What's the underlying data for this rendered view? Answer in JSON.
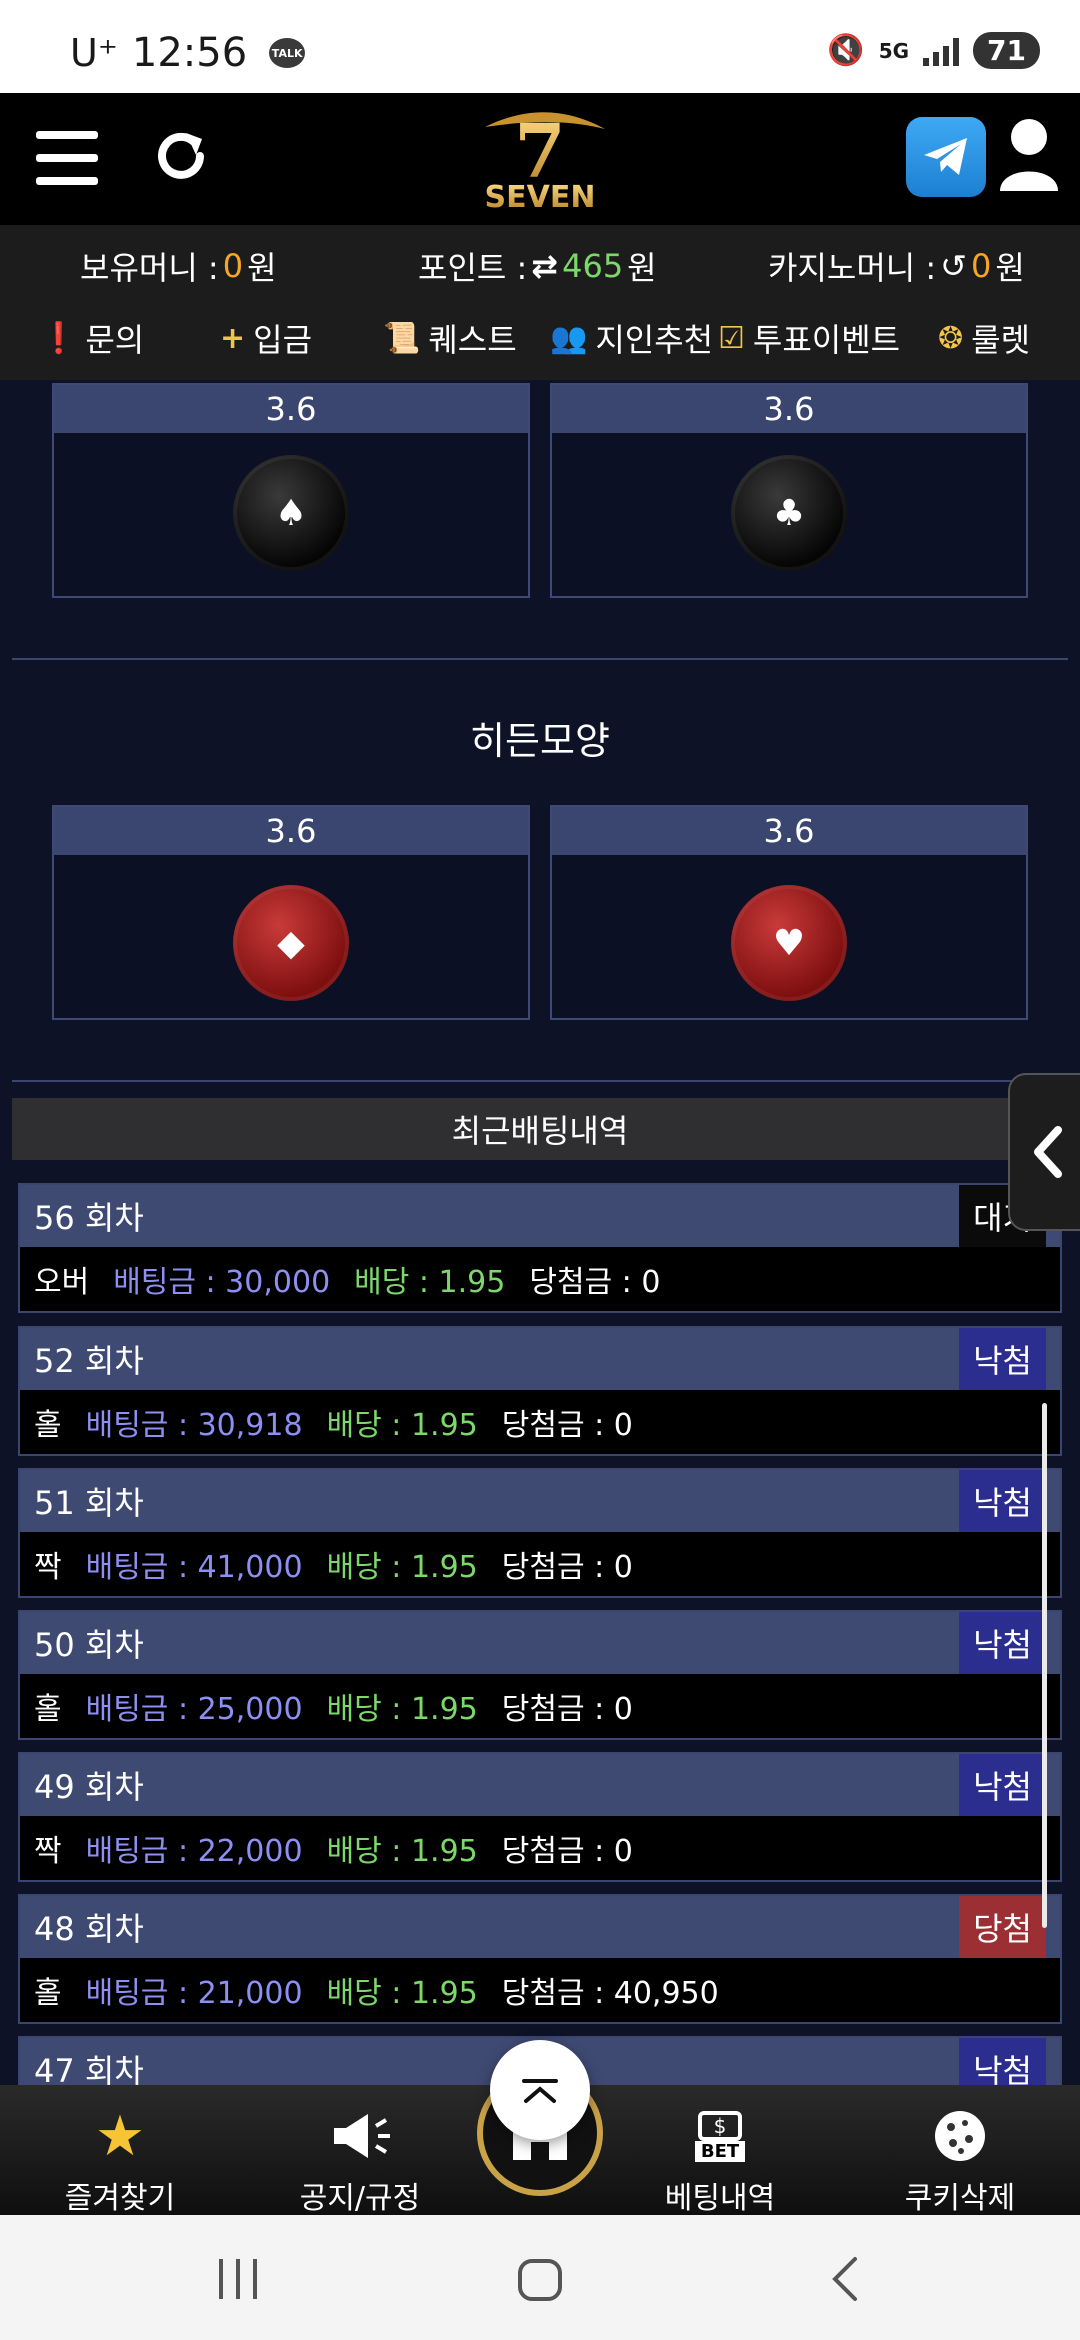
{
  "status_bar": {
    "carrier": "U⁺",
    "time": "12:56",
    "talk_label": "TALK",
    "network": "5G",
    "battery": "71"
  },
  "header": {
    "logo_text": "SEVEN",
    "logo_digit": "7"
  },
  "balance": {
    "holding_label": "보유머니 :",
    "holding_value": "0",
    "holding_unit": "원",
    "point_label": "포인트 :",
    "point_value": "465",
    "point_unit": "원",
    "casino_label": "카지노머니 :",
    "casino_value": "0",
    "casino_unit": "원"
  },
  "menu": [
    {
      "label": "문의",
      "icon": "alert-icon"
    },
    {
      "label": "입금",
      "icon": "plus-icon"
    },
    {
      "label": "퀘스트",
      "icon": "scroll-icon"
    },
    {
      "label": "지인추천",
      "icon": "people-icon"
    },
    {
      "label": "투표이벤트",
      "icon": "checkbox-icon"
    },
    {
      "label": "룰렛",
      "icon": "roulette-icon"
    }
  ],
  "bet_cards_top": [
    {
      "odds": "3.6",
      "symbol": "♠",
      "color": "black"
    },
    {
      "odds": "3.6",
      "symbol": "♣",
      "color": "black"
    }
  ],
  "hidden_section": {
    "title": "히든모양",
    "cards": [
      {
        "odds": "3.6",
        "symbol": "◆",
        "color": "red"
      },
      {
        "odds": "3.6",
        "symbol": "♥",
        "color": "red"
      }
    ]
  },
  "history": {
    "title": "최근배팅내역",
    "rows": [
      {
        "round": "56 회차",
        "pick": "오버",
        "bet": "배팅금 : 30,000",
        "odds": "배당 : 1.95",
        "win": "당첨금 : 0",
        "status": "대기",
        "status_type": "pending"
      },
      {
        "round": "52 회차",
        "pick": "홀",
        "bet": "배팅금 : 30,918",
        "odds": "배당 : 1.95",
        "win": "당첨금 : 0",
        "status": "낙첨",
        "status_type": "lose"
      },
      {
        "round": "51 회차",
        "pick": "짝",
        "bet": "배팅금 : 41,000",
        "odds": "배당 : 1.95",
        "win": "당첨금 : 0",
        "status": "낙첨",
        "status_type": "lose"
      },
      {
        "round": "50 회차",
        "pick": "홀",
        "bet": "배팅금 : 25,000",
        "odds": "배당 : 1.95",
        "win": "당첨금 : 0",
        "status": "낙첨",
        "status_type": "lose"
      },
      {
        "round": "49 회차",
        "pick": "짝",
        "bet": "배팅금 : 22,000",
        "odds": "배당 : 1.95",
        "win": "당첨금 : 0",
        "status": "낙첨",
        "status_type": "lose"
      },
      {
        "round": "48 회차",
        "pick": "홀",
        "bet": "배팅금 : 21,000",
        "odds": "배당 : 1.95",
        "win": "당첨금 : 40,950",
        "status": "당첨",
        "status_type": "win"
      },
      {
        "round": "47 회차",
        "pick": "",
        "bet": "",
        "odds": "",
        "win": "",
        "status": "낙첨",
        "status_type": "lose"
      }
    ]
  },
  "bottom_nav": {
    "favorites": "즐겨찾기",
    "notice": "공지/규정",
    "bet_history": "베팅내역",
    "bet_icon_text": "BET",
    "cookie_delete": "쿠키삭제"
  },
  "colors": {
    "background": "#0d1226",
    "card_header": "#3b4670",
    "accent_orange": "#f5a623",
    "accent_green": "#7cd86a",
    "bet_blue": "#8d8ff2",
    "lose_badge": "#2b2d8f",
    "win_badge": "#9b2f33"
  }
}
